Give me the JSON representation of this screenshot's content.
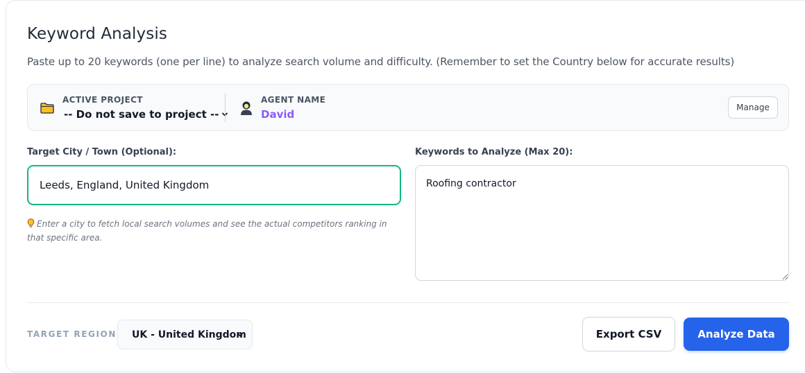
{
  "header": {
    "title": "Keyword Analysis",
    "subtitle": "Paste up to 20 keywords (one per line) to analyze search volume and difficulty. (Remember to set the Country below for accurate results)"
  },
  "project_bar": {
    "active_project_label": "ACTIVE PROJECT",
    "active_project_value": "-- Do not save to project --",
    "agent_label": "AGENT NAME",
    "agent_name": "David",
    "manage_label": "Manage",
    "icons": [
      "folder-icon",
      "agent-icon",
      "chevron-down-icon"
    ]
  },
  "city": {
    "label": "Target City / Town (Optional):",
    "value": "Leeds, England, United Kingdom",
    "hint": "Enter a city to fetch local search volumes and see the actual competitors ranking in that specific area."
  },
  "keywords": {
    "label": "Keywords to Analyze (Max 20):",
    "value": "Roofing contractor"
  },
  "footer": {
    "region_label": "TARGET REGION:",
    "region_value": "UK - United Kingdom",
    "export_label": "Export CSV",
    "analyze_label": "Analyze Data"
  },
  "colors": {
    "accent_blue": "#2563eb",
    "focus_green": "#10b981",
    "agent_purple": "#8b5cf6"
  }
}
